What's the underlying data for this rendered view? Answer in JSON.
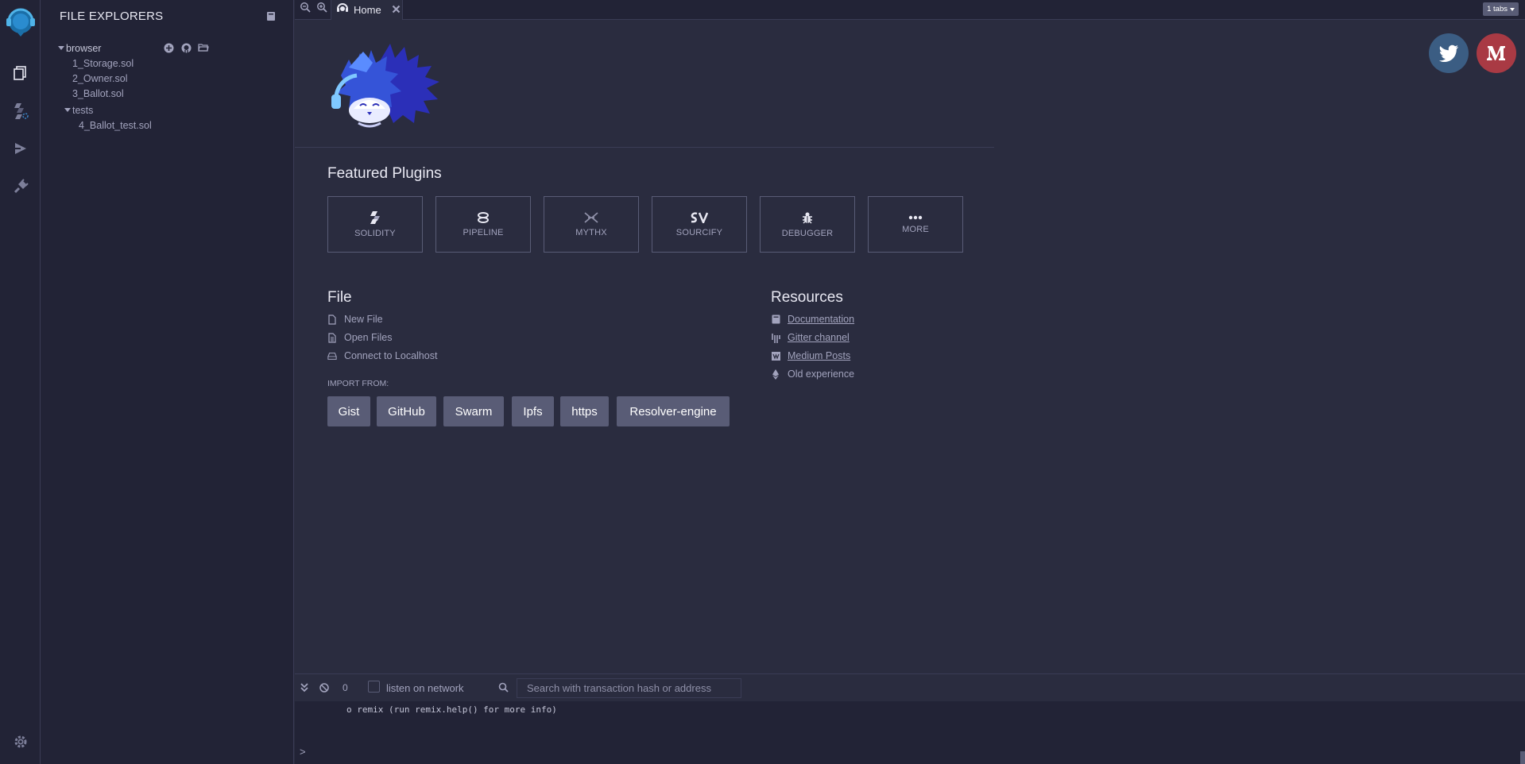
{
  "sidepanel": {
    "title": "FILE EXPLORERS",
    "tree": {
      "root": "browser",
      "files": [
        "1_Storage.sol",
        "2_Owner.sol",
        "3_Ballot.sol"
      ],
      "folder": "tests",
      "folder_files": [
        "4_Ballot_test.sol"
      ]
    }
  },
  "tabbar": {
    "home_label": "Home",
    "tabs_count": "1 tabs"
  },
  "home": {
    "featured_title": "Featured Plugins",
    "plugins": [
      "SOLIDITY",
      "PIPELINE",
      "MYTHX",
      "SOURCIFY",
      "DEBUGGER",
      "MORE"
    ],
    "file": {
      "title": "File",
      "new_file": "New File",
      "open_files": "Open Files",
      "connect": "Connect to Localhost",
      "import_label": "IMPORT FROM:",
      "import_buttons": [
        "Gist",
        "GitHub",
        "Swarm",
        "Ipfs",
        "https",
        "Resolver-engine"
      ]
    },
    "resources": {
      "title": "Resources",
      "documentation": "Documentation",
      "gitter": "Gitter channel",
      "medium": "Medium Posts",
      "old": "Old experience"
    }
  },
  "terminal": {
    "pending_count": "0",
    "listen_label": "listen on network",
    "search_placeholder": "Search with transaction hash or address",
    "output_line": "o remix (run remix.help() for more info)",
    "prompt": ">"
  },
  "colors": {
    "background": "#2a2c3f",
    "panel": "#222336",
    "accent": "#595c76",
    "text": "#a2a3bd",
    "twitter": "#3b5d83",
    "medium": "#a93a44"
  }
}
